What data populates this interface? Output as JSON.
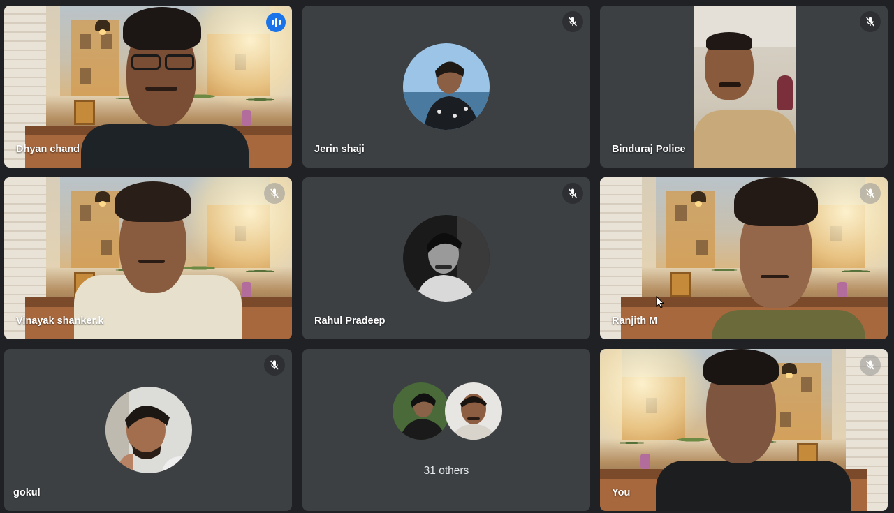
{
  "participants": [
    {
      "name": "Dhyan chand",
      "status": "speaking",
      "video": "on"
    },
    {
      "name": "Jerin shaji",
      "status": "muted",
      "video": "off"
    },
    {
      "name": "Binduraj Police",
      "status": "muted",
      "video": "on"
    },
    {
      "name": "Vinayak shanker.k",
      "status": "muted",
      "video": "on"
    },
    {
      "name": "Rahul Pradeep",
      "status": "muted",
      "video": "off"
    },
    {
      "name": "Ranjith M",
      "status": "muted",
      "video": "on"
    },
    {
      "name": "gokul",
      "status": "muted",
      "video": "off"
    },
    {
      "name": "You",
      "status": "muted",
      "video": "on"
    }
  ],
  "others": {
    "label": "31 others"
  },
  "icons": {
    "mute": "mic-off-icon",
    "speaking": "audio-level-icon"
  },
  "colors": {
    "background": "#202124",
    "tile": "#3c4043",
    "speaking_outline": "#8ab4f8",
    "speaking_badge": "#1a73e8"
  }
}
